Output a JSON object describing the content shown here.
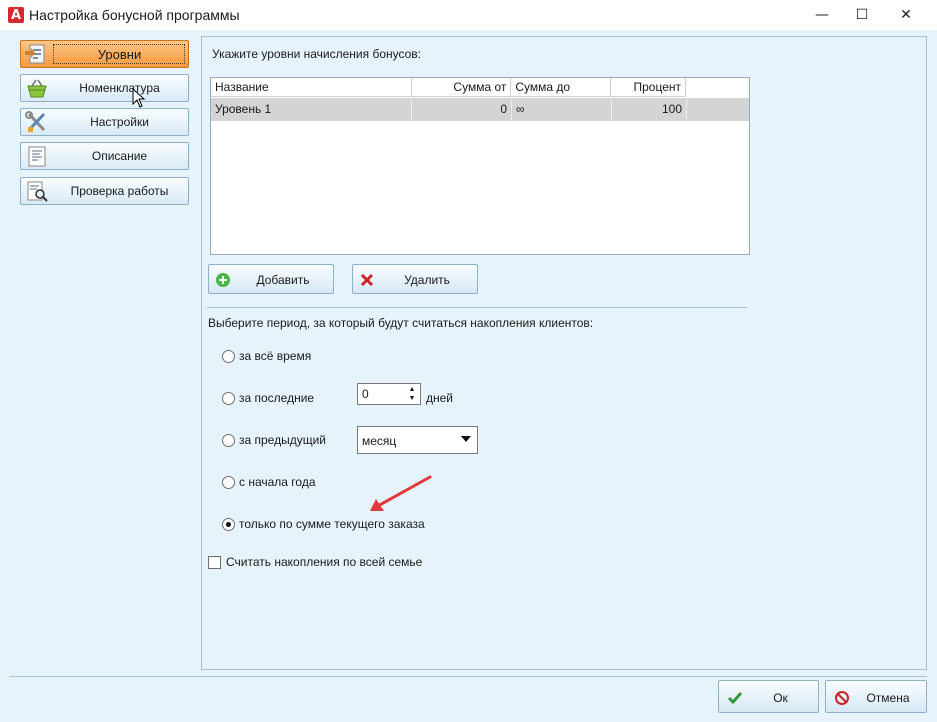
{
  "window": {
    "title": "Настройка бонусной программы",
    "app_icon_letter": "A",
    "minimize": "—",
    "maximize": "☐",
    "close": "✕"
  },
  "nav": {
    "items": [
      {
        "label": "Уровни",
        "icon": "levels-icon",
        "active": true
      },
      {
        "label": "Номенклатура",
        "icon": "basket-icon"
      },
      {
        "label": "Настройки",
        "icon": "tools-icon"
      },
      {
        "label": "Описание",
        "icon": "document-icon"
      },
      {
        "label": "Проверка работы",
        "icon": "inspect-document-icon"
      }
    ]
  },
  "levels": {
    "instruction": "Укажите уровни начисления бонусов:",
    "columns": [
      "Название",
      "Сумма от",
      "Сумма до",
      "Процент"
    ],
    "rows": [
      {
        "name": "Уровень 1",
        "from": "0",
        "to": "∞",
        "percent": "100"
      }
    ],
    "add_label": "Добавить",
    "delete_label": "Удалить"
  },
  "period": {
    "instruction": "Выберите период, за который будут считаться накопления клиентов:",
    "options": [
      {
        "label": "за всё время",
        "checked": false
      },
      {
        "label": "за последние",
        "checked": false
      },
      {
        "label": "за предыдущий",
        "checked": false
      },
      {
        "label": "с начала года",
        "checked": false
      },
      {
        "label": "только по сумме текущего заказа",
        "checked": true
      }
    ],
    "days_value": "0",
    "days_unit": "дней",
    "period_select_value": "месяц"
  },
  "family": {
    "label": "Считать накопления по всей семье",
    "checked": false
  },
  "dialog": {
    "ok_label": "Ок",
    "cancel_label": "Отмена"
  },
  "colors": {
    "background": "#e6f3fb",
    "active_nav": "#f39a3f",
    "annotation_arrow": "#e03a3a",
    "ok_icon": "#2e9b3a",
    "cancel_icon": "#c9242a"
  }
}
